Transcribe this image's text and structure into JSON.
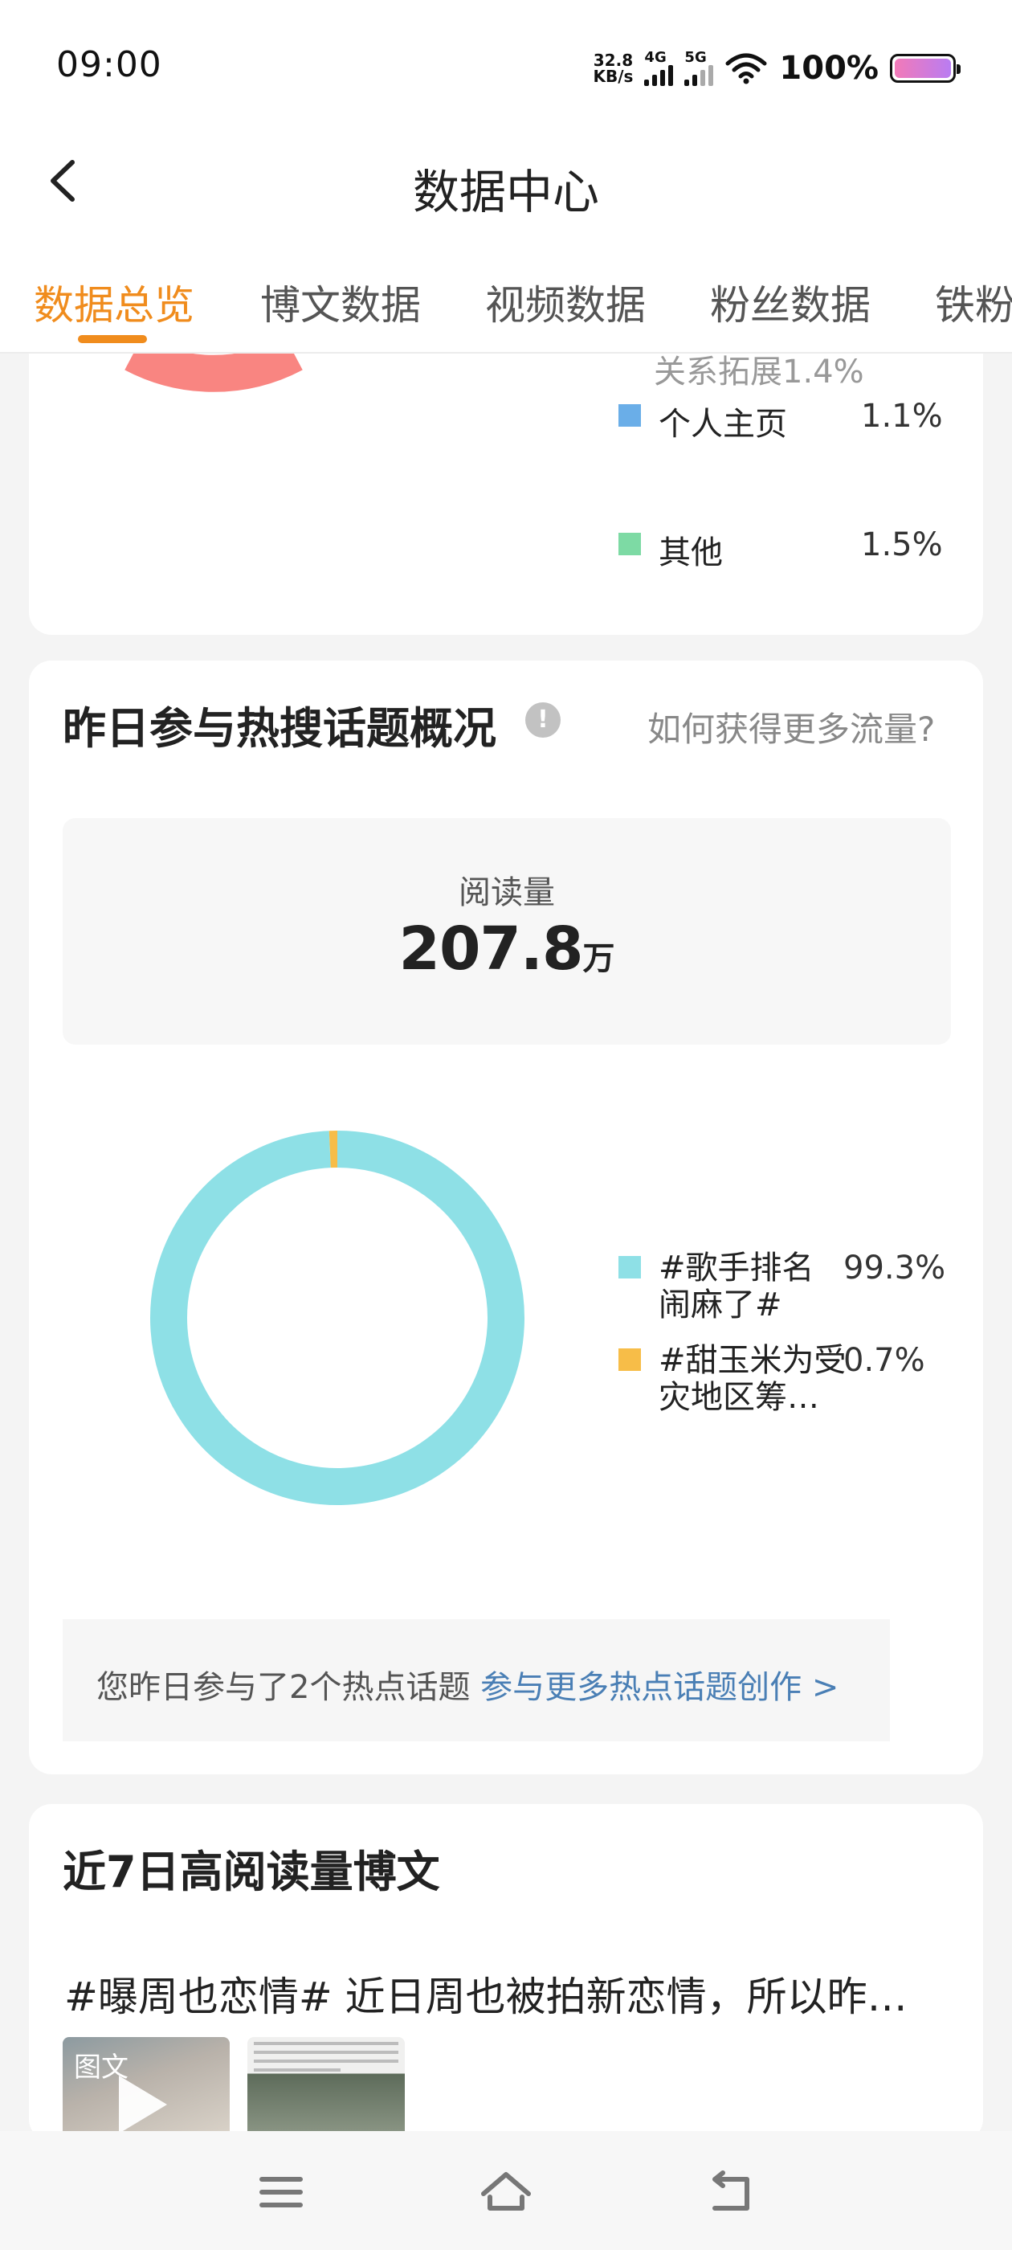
{
  "status_bar": {
    "time": "09:00",
    "net_speed_value": "32.8",
    "net_speed_unit": "KB/s",
    "sim1_label": "4G",
    "sim2_label": "5G",
    "battery_text": "100%"
  },
  "header": {
    "title": "数据中心"
  },
  "tabs": [
    {
      "label": "数据总览",
      "active": true
    },
    {
      "label": "博文数据",
      "active": false
    },
    {
      "label": "视频数据",
      "active": false
    },
    {
      "label": "粉丝数据",
      "active": false
    },
    {
      "label": "铁粉",
      "active": false
    }
  ],
  "traffic_card": {
    "cut_label": "关系拓展1.4%",
    "legend": [
      {
        "label": "个人主页",
        "pct": "1.1%",
        "color": "#6aaee8"
      },
      {
        "label": "其他",
        "pct": "1.5%",
        "color": "#7ddaa4"
      }
    ],
    "ring_color": "#f98581"
  },
  "hot_topics": {
    "title": "昨日参与热搜话题概况",
    "info_icon": "!",
    "help_link": "如何获得更多流量?",
    "read_label": "阅读量",
    "read_value": "207.8",
    "read_unit": "万",
    "legend": [
      {
        "label_line1": "#歌手排名",
        "label_line2": "闹麻了#",
        "pct": "99.3%",
        "color": "#8ee0e6"
      },
      {
        "label_line1": "#甜玉米为受",
        "label_line2": "灾地区筹…",
        "pct": "0.7%",
        "color": "#f7bd48"
      }
    ],
    "summary_text": "您昨日参与了2个热点话题 ",
    "summary_link": "参与更多热点话题创作 >"
  },
  "chart_data": {
    "type": "pie",
    "title": "",
    "categories": [
      "#歌手排名闹麻了#",
      "#甜玉米为受灾地区筹…"
    ],
    "values": [
      99.3,
      0.7
    ],
    "unit": "%",
    "colors": [
      "#8ee0e6",
      "#f7bd48"
    ],
    "style": "donut"
  },
  "top_posts": {
    "title": "近7日高阅读量博文",
    "post_text": "#曝周也恋情# 近日周也被拍新恋情，所以昨…",
    "thumb_badge": "图文"
  }
}
